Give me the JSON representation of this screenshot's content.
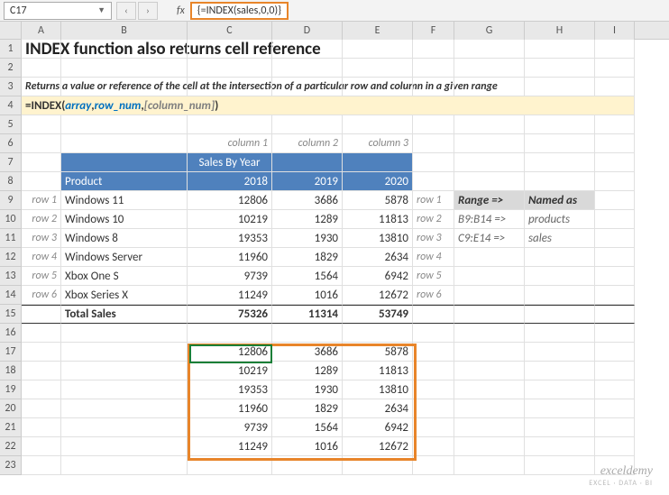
{
  "topbar": {
    "cell_ref": "C17",
    "fx_label": "fx",
    "formula": "{=INDEX(sales,0,0)}"
  },
  "columns": [
    "A",
    "B",
    "C",
    "D",
    "E",
    "F",
    "G",
    "H",
    "I"
  ],
  "rows": [
    "1",
    "2",
    "3",
    "4",
    "5",
    "6",
    "7",
    "8",
    "9",
    "10",
    "11",
    "12",
    "13",
    "14",
    "15",
    "16",
    "17",
    "18",
    "19",
    "20",
    "21",
    "22",
    "23"
  ],
  "title": "INDEX function also returns cell reference",
  "description": "Returns a value or reference of the cell at the intersection of a particular row and column in a given range",
  "syntax": {
    "pre": "=INDEX(",
    "arr": " array",
    "c1": ",  ",
    "rn": "row_num",
    "c2": ", ",
    "cn": "[column_num]",
    "post": ")"
  },
  "colTags": [
    "column 1",
    "column 2",
    "column 3"
  ],
  "rowTags": [
    "row 1",
    "row 2",
    "row 3",
    "row 4",
    "row 5",
    "row 6"
  ],
  "header": {
    "merged": "Sales By Year",
    "product": "Product",
    "y1": "2018",
    "y2": "2019",
    "y3": "2020"
  },
  "products": [
    {
      "name": "Windows 11",
      "v": [
        12806,
        3686,
        5878
      ]
    },
    {
      "name": "Windows 10",
      "v": [
        10219,
        1289,
        11813
      ]
    },
    {
      "name": "Windows 8",
      "v": [
        19353,
        1930,
        13810
      ]
    },
    {
      "name": "Windows Server",
      "v": [
        11960,
        1829,
        2634
      ]
    },
    {
      "name": "Xbox One S",
      "v": [
        9739,
        1564,
        6942
      ]
    },
    {
      "name": "Xbox Series X",
      "v": [
        11249,
        1016,
        12672
      ]
    }
  ],
  "totals": {
    "label": "Total Sales",
    "v": [
      75326,
      11314,
      53749
    ]
  },
  "ranges": {
    "h1": "Range =>",
    "h2": "Named as",
    "r1a": "B9:B14 =>",
    "r1b": "products",
    "r2a": "C9:E14 =>",
    "r2b": "sales"
  },
  "result": [
    [
      12806,
      3686,
      5878
    ],
    [
      10219,
      1289,
      11813
    ],
    [
      19353,
      1930,
      13810
    ],
    [
      11960,
      1829,
      2634
    ],
    [
      9739,
      1564,
      6942
    ],
    [
      11249,
      1016,
      12672
    ]
  ],
  "watermark": {
    "w1": "exceldemy",
    "w2": "EXCEL · DATA · BI"
  }
}
